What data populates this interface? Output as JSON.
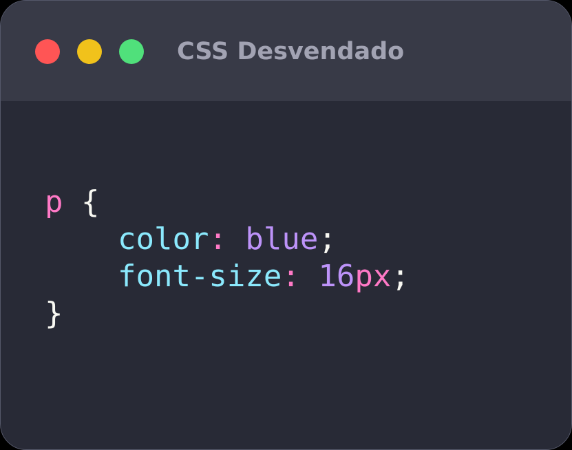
{
  "window": {
    "title": "CSS Desvendado",
    "controls": [
      {
        "name": "close-button",
        "color": "#ff5555"
      },
      {
        "name": "minimize-button",
        "color": "#f1c21b"
      },
      {
        "name": "maximize-button",
        "color": "#50e07b"
      }
    ]
  },
  "code": {
    "lines": [
      [
        {
          "text": "p",
          "color": "#ff79c6"
        },
        {
          "text": " ",
          "color": "#f8f8f2"
        },
        {
          "text": "{",
          "color": "#f8f8f2"
        }
      ],
      [
        {
          "text": "    ",
          "color": "#f8f8f2"
        },
        {
          "text": "color",
          "color": "#8be9fd"
        },
        {
          "text": ":",
          "color": "#ff79c6"
        },
        {
          "text": " ",
          "color": "#f8f8f2"
        },
        {
          "text": "blue",
          "color": "#bd93f9"
        },
        {
          "text": ";",
          "color": "#f8f8f2"
        }
      ],
      [
        {
          "text": "    ",
          "color": "#f8f8f2"
        },
        {
          "text": "font-size",
          "color": "#8be9fd"
        },
        {
          "text": ":",
          "color": "#ff79c6"
        },
        {
          "text": " ",
          "color": "#f8f8f2"
        },
        {
          "text": "16",
          "color": "#bd93f9"
        },
        {
          "text": "px",
          "color": "#ff79c6"
        },
        {
          "text": ";",
          "color": "#f8f8f2"
        }
      ],
      [
        {
          "text": "}",
          "color": "#f8f8f2"
        }
      ]
    ]
  }
}
